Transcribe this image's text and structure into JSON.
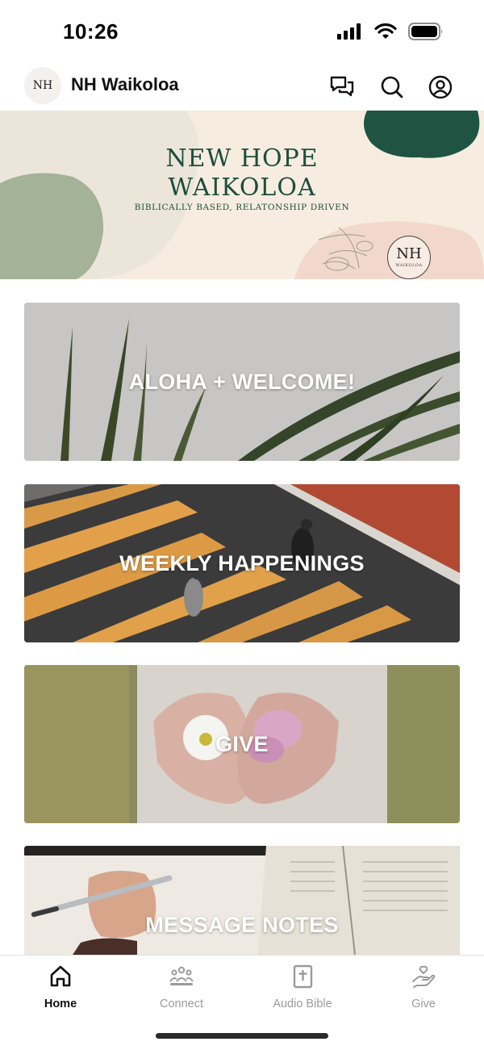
{
  "status": {
    "time": "10:26"
  },
  "header": {
    "logo_text": "NH",
    "title": "NH Waikoloa"
  },
  "banner": {
    "line1": "NEW HOPE",
    "line2": "WAIKOLOA",
    "tagline": "BIBLICALLY BASED, RELATONSHIP DRIVEN",
    "mark_nh": "NH",
    "mark_sub": "WAIKOLOA"
  },
  "cards": [
    {
      "label": "ALOHA + WELCOME!"
    },
    {
      "label": "WEEKLY HAPPENINGS"
    },
    {
      "label": "GIVE"
    },
    {
      "label": "MESSAGE NOTES"
    }
  ],
  "tabs": [
    {
      "label": "Home",
      "icon": "home-icon"
    },
    {
      "label": "Connect",
      "icon": "people-icon"
    },
    {
      "label": "Audio Bible",
      "icon": "bible-icon"
    },
    {
      "label": "Give",
      "icon": "give-hand-icon"
    }
  ]
}
